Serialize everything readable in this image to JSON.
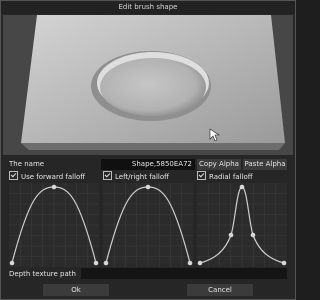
{
  "window": {
    "title": "Edit brush shape"
  },
  "name": {
    "label": "The name",
    "value": "Shape,5850EA72"
  },
  "buttons": {
    "copy_alpha": "Copy Alpha",
    "paste_alpha": "Paste Alpha",
    "ok": "Ok",
    "cancel": "Cancel"
  },
  "falloffs": [
    {
      "label": "Use forward falloff",
      "checked": true
    },
    {
      "label": "Left/right falloff",
      "checked": true
    },
    {
      "label": "Radial falloff",
      "checked": true
    }
  ],
  "depth": {
    "label": "Depth texture path",
    "value": ""
  }
}
